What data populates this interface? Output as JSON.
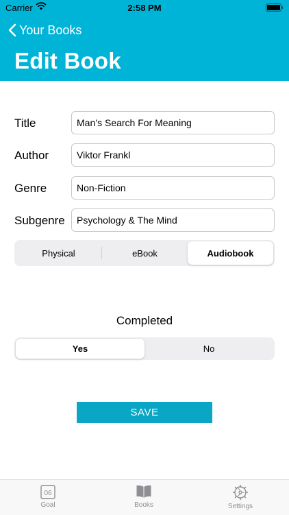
{
  "status_bar": {
    "carrier": "Carrier",
    "time": "2:58 PM"
  },
  "nav": {
    "back_label": "Your Books",
    "title": "Edit Book"
  },
  "form": {
    "title": {
      "label": "Title",
      "value": "Man’s Search For Meaning"
    },
    "author": {
      "label": "Author",
      "value": "Viktor Frankl"
    },
    "genre": {
      "label": "Genre",
      "value": "Non-Fiction"
    },
    "subgenre": {
      "label": "Subgenre",
      "value": "Psychology & The Mind"
    }
  },
  "format": {
    "options": [
      "Physical",
      "eBook",
      "Audiobook"
    ],
    "selected": "Audiobook"
  },
  "completed": {
    "label": "Completed",
    "options": [
      "Yes",
      "No"
    ],
    "selected": "Yes"
  },
  "save_label": "SAVE",
  "tab_bar": {
    "items": [
      {
        "label": "Goal",
        "icon": "calendar-icon",
        "badge": "06"
      },
      {
        "label": "Books",
        "icon": "book-icon"
      },
      {
        "label": "Settings",
        "icon": "gear-icon"
      }
    ]
  },
  "colors": {
    "header": "#00b4d8",
    "save_button": "#0aa6c5",
    "tab_inactive": "#8e8e93"
  }
}
